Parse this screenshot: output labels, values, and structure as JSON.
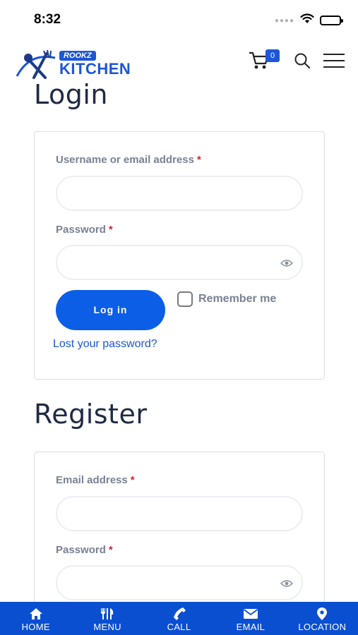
{
  "status_bar": {
    "time": "8:32"
  },
  "header": {
    "logo_small": "ROOKZ",
    "logo_main": "KITCHEN",
    "cart_count": "0"
  },
  "login": {
    "title": "Login",
    "username_label": "Username or email address",
    "required_mark": "*",
    "password_label": "Password",
    "login_button": "Log in",
    "remember_label": "Remember me",
    "remember_checked": false,
    "lost_password": "Lost your password?"
  },
  "register": {
    "title": "Register",
    "email_label": "Email address",
    "required_mark": "*",
    "password_label": "Password"
  },
  "bottom_nav": {
    "items": [
      {
        "label": "HOME",
        "icon": "home-icon"
      },
      {
        "label": "MENU",
        "icon": "fork-knife-icon"
      },
      {
        "label": "CALL",
        "icon": "phone-icon"
      },
      {
        "label": "EMAIL",
        "icon": "envelope-icon"
      },
      {
        "label": "LOCATION",
        "icon": "map-pin-icon"
      }
    ]
  },
  "colors": {
    "brand": "#1d56d6",
    "button": "#0d5ee6",
    "nav_bar": "#0a4fd0",
    "required": "#e0202a"
  }
}
